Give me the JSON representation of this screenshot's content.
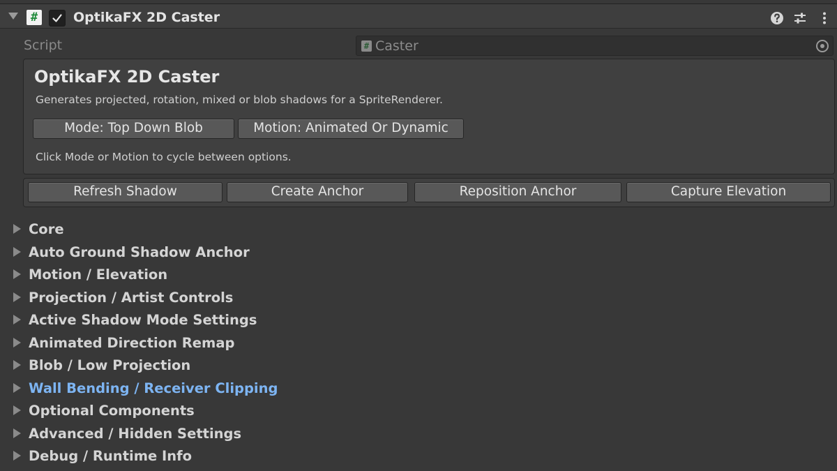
{
  "component": {
    "title": "OptikaFX 2D Caster",
    "enabled": true,
    "script_icon": "#"
  },
  "script_row": {
    "label": "Script",
    "value": "Caster",
    "value_icon": "#"
  },
  "info": {
    "title": "OptikaFX 2D Caster",
    "description": "Generates projected, rotation, mixed or blob shadows for a SpriteRenderer.",
    "mode_button": "Mode: Top Down Blob",
    "motion_button": "Motion: Animated Or Dynamic",
    "hint": "Click Mode or Motion to cycle between options."
  },
  "actions": {
    "refresh": "Refresh Shadow",
    "create_anchor": "Create Anchor",
    "reposition_anchor": "Reposition Anchor",
    "capture_elevation": "Capture Elevation"
  },
  "sections": [
    {
      "label": "Core",
      "active": false
    },
    {
      "label": "Auto Ground Shadow Anchor",
      "active": false
    },
    {
      "label": "Motion / Elevation",
      "active": false
    },
    {
      "label": "Projection / Artist Controls",
      "active": false
    },
    {
      "label": "Active Shadow Mode Settings",
      "active": false
    },
    {
      "label": "Animated Direction Remap",
      "active": false
    },
    {
      "label": "Blob / Low Projection",
      "active": false
    },
    {
      "label": "Wall Bending / Receiver Clipping",
      "active": true
    },
    {
      "label": "Optional Components",
      "active": false
    },
    {
      "label": "Advanced / Hidden Settings",
      "active": false
    },
    {
      "label": "Debug / Runtime Info",
      "active": false
    }
  ],
  "colors": {
    "background": "#383838",
    "header": "#3e3e3e",
    "button": "#585858",
    "active_link": "#7db4f2",
    "script_icon_hash": "#1f8a3a"
  },
  "header_icons": [
    "help-icon",
    "preset-settings-icon",
    "more-options-icon"
  ]
}
